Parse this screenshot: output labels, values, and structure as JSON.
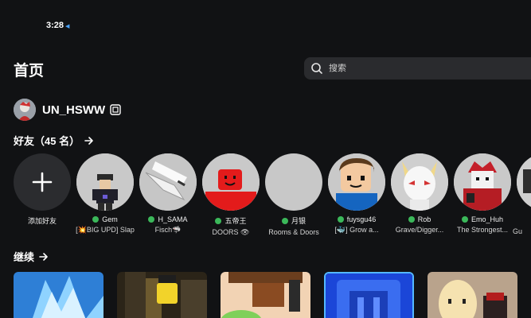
{
  "status_bar": {
    "time": "3:28"
  },
  "header": {
    "title": "首页"
  },
  "search": {
    "placeholder": "搜索"
  },
  "profile": {
    "username": "UN_HSWW"
  },
  "friends_section": {
    "title": "好友（45 名）"
  },
  "friends": [
    {
      "name": "添加好友",
      "status": "",
      "online": false
    },
    {
      "name": "Gem",
      "status": "[💥BIG UPD] Slap",
      "online": true
    },
    {
      "name": "H_SAMA",
      "status": "Fisch🦈",
      "online": true
    },
    {
      "name": "五帝王",
      "status": "DOORS 👁",
      "online": true
    },
    {
      "name": "月银",
      "status": "Rooms & Doors",
      "online": true
    },
    {
      "name": "fuysgu46",
      "status": "[🐳] Grow a...",
      "online": true
    },
    {
      "name": "Rob",
      "status": "Grave/Digger...",
      "online": true
    },
    {
      "name": "Emo_Huh",
      "status": "The Strongest...",
      "online": true
    },
    {
      "name": "",
      "status": "Gu",
      "online": false
    }
  ],
  "continue_section": {
    "title": "继续"
  },
  "colors": {
    "background": "#111214",
    "online": "#3bb85a",
    "search_bg": "#2a2b2e"
  }
}
